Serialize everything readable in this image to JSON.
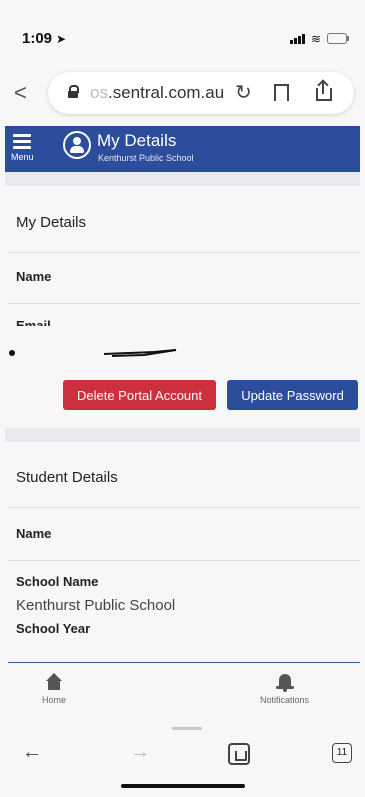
{
  "status_bar": {
    "time": "1:09"
  },
  "browser": {
    "url_faded": "os",
    "url_main": ".sentral.com.au"
  },
  "app_header": {
    "menu_label": "Menu",
    "title": "My Details",
    "subtitle": "Kenthurst Public School"
  },
  "my_details": {
    "heading": "My Details",
    "name_label": "Name",
    "email_label": "Email",
    "delete_button": "Delete Portal Account",
    "update_button": "Update Password"
  },
  "student_details": {
    "heading": "Student Details",
    "name_label": "Name",
    "school_name_label": "School Name",
    "school_name_value": "Kenthurst Public School",
    "school_year_label": "School Year"
  },
  "app_tabs": {
    "home": "Home",
    "notifications": "Notifications"
  },
  "safari_toolbar": {
    "tab_count": "11"
  },
  "colors": {
    "brand_blue": "#2b4d9b",
    "danger_red": "#cc2f3d"
  },
  "icons": [
    "location-arrow-icon",
    "signal-icon",
    "wifi-icon",
    "battery-icon",
    "back-chevron-icon",
    "lock-icon",
    "reload-icon",
    "bookmark-icon",
    "share-icon",
    "menu-icon",
    "user-icon",
    "home-icon",
    "bell-icon",
    "tabs-icon"
  ]
}
